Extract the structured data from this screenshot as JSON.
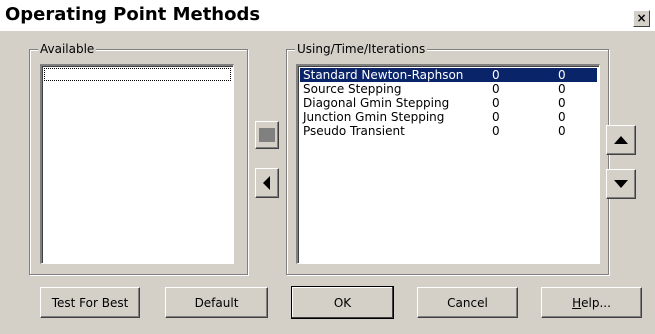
{
  "window": {
    "title": "Operating Point Methods",
    "close_glyph": "×"
  },
  "available": {
    "label": "Available",
    "items": []
  },
  "using": {
    "label": "Using/Time/Iterations",
    "rows": [
      {
        "name": "Standard Newton-Raphson",
        "time": "0",
        "iterations": "0",
        "selected": true
      },
      {
        "name": "Source Stepping",
        "time": "0",
        "iterations": "0",
        "selected": false
      },
      {
        "name": "Diagonal Gmin Stepping",
        "time": "0",
        "iterations": "0",
        "selected": false
      },
      {
        "name": "Junction Gmin Stepping",
        "time": "0",
        "iterations": "0",
        "selected": false
      },
      {
        "name": "Pseudo Transient",
        "time": "0",
        "iterations": "0",
        "selected": false
      }
    ]
  },
  "transfer": {
    "add_icon": "square-icon",
    "remove_icon": "left-triangle-icon"
  },
  "order": {
    "up_icon": "up-triangle-icon",
    "down_icon": "down-triangle-icon"
  },
  "buttons": {
    "test_for_best": "Test For Best",
    "default": "Default",
    "ok": "OK",
    "cancel": "Cancel",
    "help_mnemonic": "H",
    "help_rest": "elp..."
  },
  "colors": {
    "face": "#d4d0c8",
    "selection": "#0a246a"
  }
}
